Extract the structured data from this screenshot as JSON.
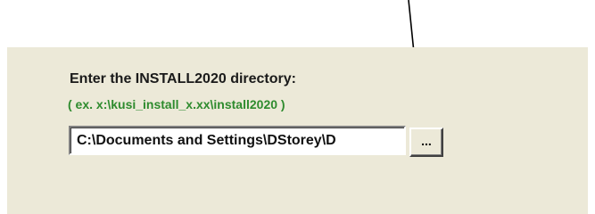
{
  "dialog": {
    "directory_label": "Enter the INSTALL2020 directory:",
    "example_hint": "( ex.  x:\\kusi_install_x.xx\\install2020 )",
    "path_input": {
      "value": "C:\\Documents and Settings\\DStorey\\D"
    },
    "browse_button_label": "..."
  },
  "annotation": {
    "arrow_color": "#000000",
    "arrow_points_to": "browse-button"
  },
  "colors": {
    "panel_background": "#ece9d8",
    "hint_text": "#2e8b2e"
  }
}
